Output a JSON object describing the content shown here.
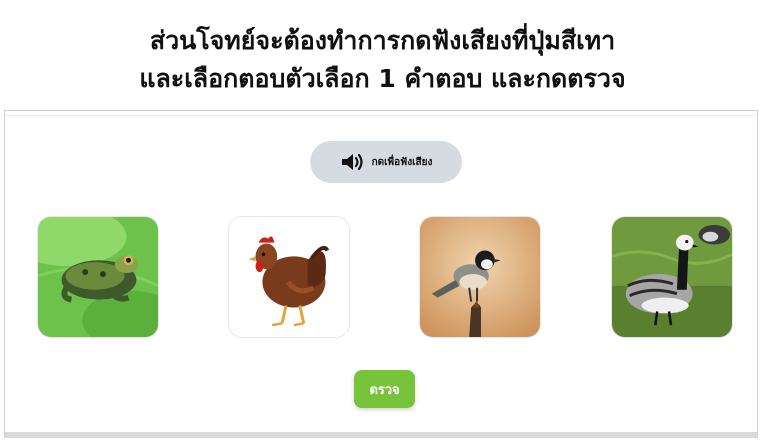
{
  "instruction": {
    "line1": "ส่วนโจทย์จะต้องทำการกดฟังเสียงที่ปุ่มสีเทา",
    "line2": "และเลือกตอบตัวเลือก 1 คำตอบ และกดตรวจ"
  },
  "listen_button": {
    "label": "กดเพื่อฟังเสียง",
    "icon": "speaker-icon",
    "color": "#d6dbe2"
  },
  "options": [
    {
      "subject": "frog"
    },
    {
      "subject": "hen"
    },
    {
      "subject": "chickadee"
    },
    {
      "subject": "barnacle goose"
    }
  ],
  "check_button": {
    "label": "ตรวจ",
    "color": "#77c43a"
  }
}
